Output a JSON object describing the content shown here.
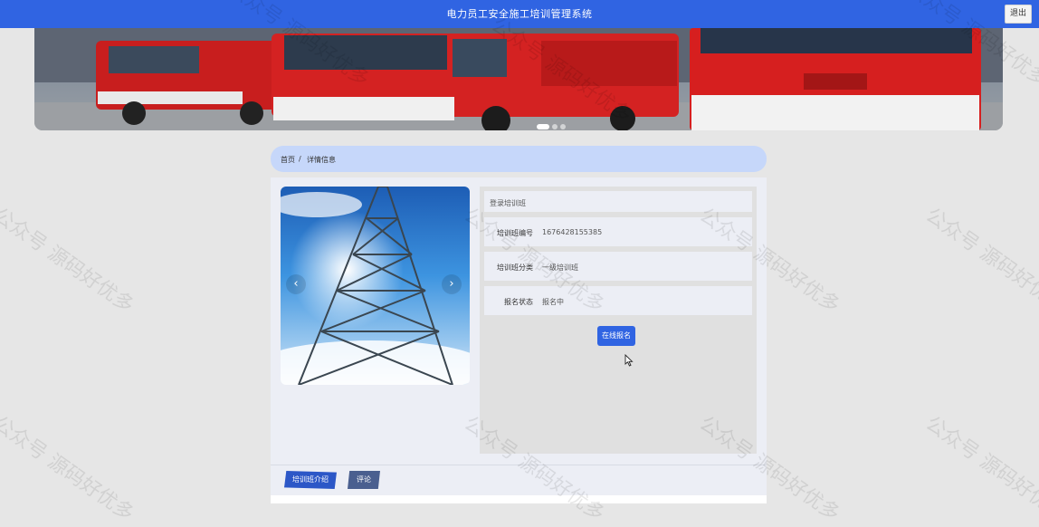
{
  "header": {
    "title": "电力员工安全施工培训管理系统",
    "logout_label": "退出"
  },
  "banner": {
    "image": "fire-trucks-banner",
    "slide_count": 3,
    "active_slide": 1
  },
  "breadcrumb": {
    "home": "首页",
    "separator": "/",
    "current": "详情信息"
  },
  "detail": {
    "image": "power-tower-photo",
    "prev_glyph": "‹",
    "next_glyph": "›",
    "fields": [
      {
        "label": "",
        "value": "登录培训班"
      },
      {
        "label": "培训班编号",
        "value": "1676428155385"
      },
      {
        "label": "培训班分类",
        "value": "一级培训班"
      },
      {
        "label": "报名状态",
        "value": "报名中"
      }
    ],
    "signup_label": "在线报名"
  },
  "tabs": [
    {
      "label": "培训班介绍"
    },
    {
      "label": "评论"
    }
  ],
  "watermark": "公众号 源码好优多",
  "colors": {
    "primary": "#3064e2",
    "breadcrumb_bg": "#c6d7fa",
    "page_bg": "#e6e6e6"
  }
}
